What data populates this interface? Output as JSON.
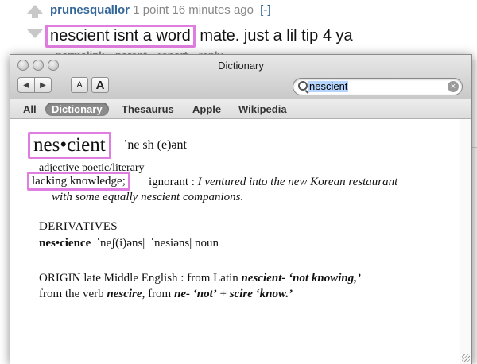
{
  "comment": {
    "author": "prunesquallor",
    "points": "1 point",
    "time": "16 minutes ago",
    "toggle": "[-]",
    "body_highlight": "nescient isnt a word",
    "body_rest": "mate. just a lil tip 4 ya",
    "buttons": [
      "permalink",
      "parent",
      "report",
      "reply"
    ]
  },
  "window": {
    "title": "Dictionary",
    "search_value": "nescient",
    "font_small": "A",
    "font_large": "A",
    "tabs": [
      "All",
      "Dictionary",
      "Thesaurus",
      "Apple",
      "Wikipedia"
    ],
    "active_tab": "Dictionary"
  },
  "entry": {
    "headword": "nes•cient",
    "pronunciation": "ˈne sh (ē)ənt|",
    "part_of_speech": "adjective poetic/literary",
    "definition_highlight": "lacking knowledge;",
    "definition_rest": "ignorant :",
    "example_1": "I ventured into the new Korean restaurant",
    "example_2": "with some equally nescient companions.",
    "derivatives_heading": "DERIVATIVES",
    "derivative_word": "nes•cience",
    "derivative_pron": "|ˈneʃ(i)əns| |ˈnesiəns| noun",
    "origin_line1_a": "ORIGIN late Middle English : from Latin",
    "origin_line1_b": "nescient-",
    "origin_line1_c": "‘not knowing,’",
    "origin_line2_a": "from the verb",
    "origin_line2_b": "nescire",
    "origin_line2_c": ", from",
    "origin_line2_d": "ne-",
    "origin_line2_e": "‘not’",
    "origin_line2_f": "+",
    "origin_line2_g": "scire",
    "origin_line2_h": "‘know.’"
  },
  "colors": {
    "highlight": "#e07de0",
    "link": "#336699",
    "selection": "#b5d5ff"
  }
}
